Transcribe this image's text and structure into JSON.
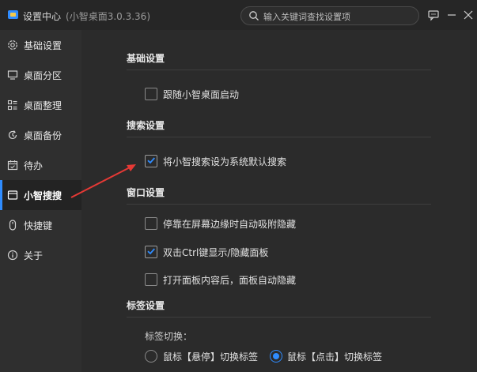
{
  "window": {
    "title": "设置中心",
    "subtitle": "(小智桌面3.0.3.36)",
    "search_placeholder": "输入关键词查找设置项"
  },
  "sidebar": {
    "items": [
      {
        "label": "基础设置",
        "icon": "gear-icon"
      },
      {
        "label": "桌面分区",
        "icon": "monitor-icon"
      },
      {
        "label": "桌面整理",
        "icon": "organize-icon"
      },
      {
        "label": "桌面备份",
        "icon": "backup-icon"
      },
      {
        "label": "待办",
        "icon": "calendar-icon"
      },
      {
        "label": "小智搜搜",
        "icon": "window-icon",
        "active": true
      },
      {
        "label": "快捷键",
        "icon": "mouse-icon"
      },
      {
        "label": "关于",
        "icon": "info-icon"
      }
    ]
  },
  "main": {
    "basic": {
      "title": "基础设置",
      "autostart": {
        "label": "跟随小智桌面启动",
        "checked": false
      }
    },
    "search": {
      "title": "搜索设置",
      "default_search": {
        "label": "将小智搜索设为系统默认搜索",
        "checked": true
      }
    },
    "window": {
      "title": "窗口设置",
      "options": [
        {
          "label": "停靠在屏幕边缘时自动吸附隐藏",
          "checked": false
        },
        {
          "label": "双击Ctrl键显示/隐藏面板",
          "checked": true
        },
        {
          "label": "打开面板内容后，面板自动隐藏",
          "checked": false
        }
      ]
    },
    "tabs": {
      "title": "标签设置",
      "switch_label": "标签切换：",
      "radios": [
        {
          "label": "鼠标【悬停】切换标签",
          "selected": false
        },
        {
          "label": "鼠标【点击】切换标签",
          "selected": true
        }
      ]
    }
  },
  "colors": {
    "accent": "#2f8cff",
    "annotation_arrow": "#e53935",
    "background": "#2b2b2b",
    "sidebar": "#2f2f2f"
  }
}
